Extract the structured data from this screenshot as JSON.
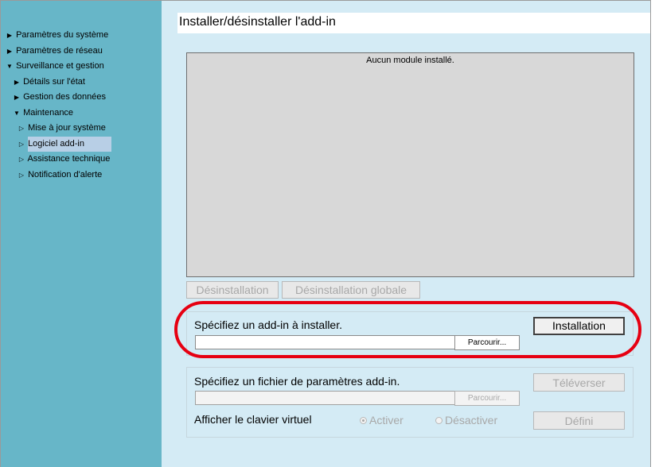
{
  "sidebar": {
    "items": [
      {
        "label": "Paramètres du système",
        "caret": "▶"
      },
      {
        "label": "Paramètres de réseau",
        "caret": "▶"
      },
      {
        "label": "Surveillance et gestion",
        "caret": "▼"
      },
      {
        "label": "Détails sur l'état",
        "caret": "▶"
      },
      {
        "label": "Gestion des données",
        "caret": "▶"
      },
      {
        "label": "Maintenance",
        "caret": "▼"
      },
      {
        "label": "Mise à jour système",
        "caret": "▷"
      },
      {
        "label": "Logiciel add-in",
        "caret": "▷"
      },
      {
        "label": "Assistance technique",
        "caret": "▷"
      },
      {
        "label": "Notification d'alerte",
        "caret": "▷"
      }
    ]
  },
  "main": {
    "title": "Installer/désinstaller l'add-in",
    "module_list_empty": "Aucun module installé.",
    "uninstall_label": "Désinstallation",
    "uninstall_all_label": "Désinstallation globale",
    "install": {
      "label": "Spécifiez un add-in à installer.",
      "path_value": "",
      "browse_label": "Parcourir...",
      "install_label": "Installation"
    },
    "settings": {
      "label": "Spécifiez un fichier de paramètres add-in.",
      "path_value": "",
      "browse_label": "Parcourir...",
      "upload_label": "Téléverser",
      "keyboard_label": "Afficher le clavier virtuel",
      "radio_on_label": "Activer",
      "radio_off_label": "Désactiver",
      "define_label": "Défini"
    }
  },
  "colors": {
    "sidebar_bg": "#67b6c8",
    "main_bg": "#d4ebf5",
    "selected_item_bg": "#b8cfe6",
    "highlight_ring": "#e60012"
  },
  "icons": {
    "expanded": "triangle-down-icon",
    "collapsed": "triangle-right-icon",
    "leaf": "triangle-outline-right-icon"
  }
}
